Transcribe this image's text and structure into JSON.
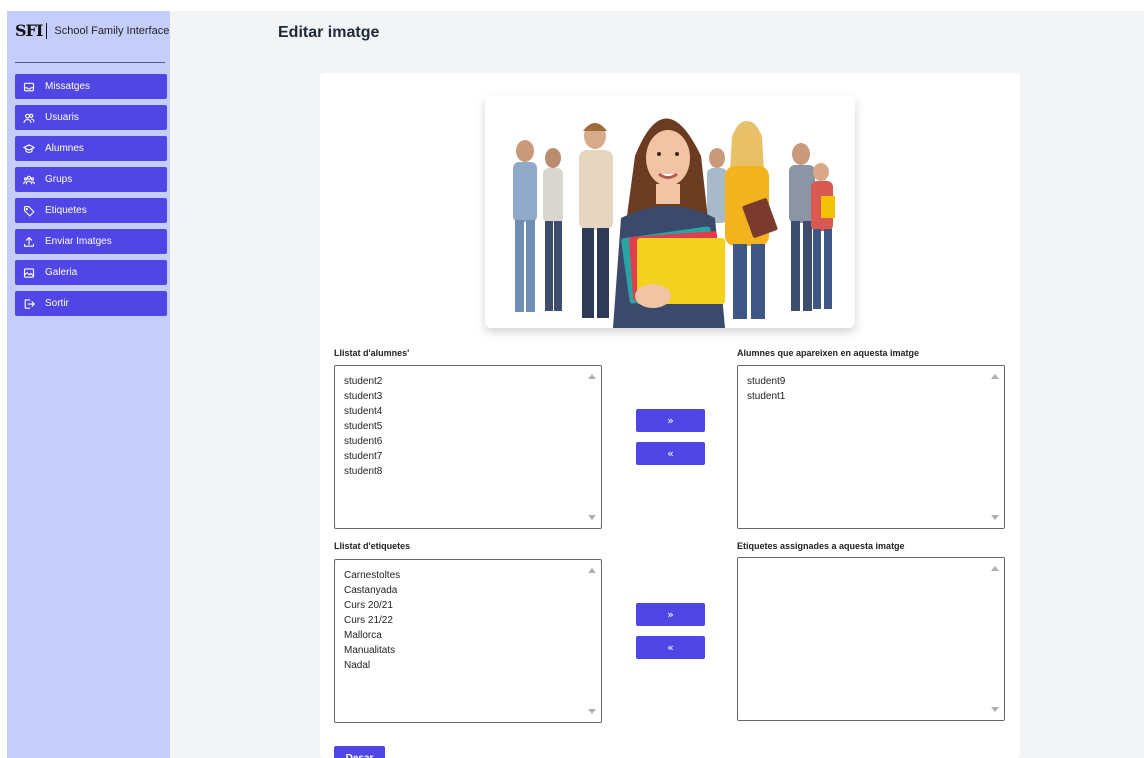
{
  "brand": {
    "logo": "SFI",
    "name": "School Family Interface"
  },
  "sidebar": {
    "items": [
      {
        "label": "Missatges",
        "icon": "inbox-icon"
      },
      {
        "label": "Usuaris",
        "icon": "users-icon"
      },
      {
        "label": "Alumnes",
        "icon": "graduation-cap-icon"
      },
      {
        "label": "Grups",
        "icon": "user-group-icon"
      },
      {
        "label": "Etiquetes",
        "icon": "tag-icon"
      },
      {
        "label": "Enviar Imatges",
        "icon": "upload-icon"
      },
      {
        "label": "Galeria",
        "icon": "photo-icon"
      },
      {
        "label": "Sortir",
        "icon": "logout-icon"
      }
    ]
  },
  "page": {
    "title": "Editar imatge"
  },
  "students": {
    "available_label": "Llistat d'alumnes'",
    "available": [
      "student2",
      "student3",
      "student4",
      "student5",
      "student6",
      "student7",
      "student8"
    ],
    "assigned_label": "Alumnes que apareixen en aquesta imatge",
    "assigned": [
      "student9",
      "student1"
    ]
  },
  "tags": {
    "available_label": "Llistat d'etiquetes",
    "available": [
      "Carnestoltes",
      "Castanyada",
      "Curs 20/21",
      "Curs 21/22",
      "Mallorca",
      "Manualitats",
      "Nadal"
    ],
    "assigned_label": "Etiquetes assignades a aquesta imatge",
    "assigned": []
  },
  "buttons": {
    "add": "»",
    "remove": "«",
    "save": "Desar"
  },
  "colors": {
    "accent": "#4f46e5",
    "sidebar_bg": "#c5cefb",
    "main_bg": "#f3f4f6"
  }
}
